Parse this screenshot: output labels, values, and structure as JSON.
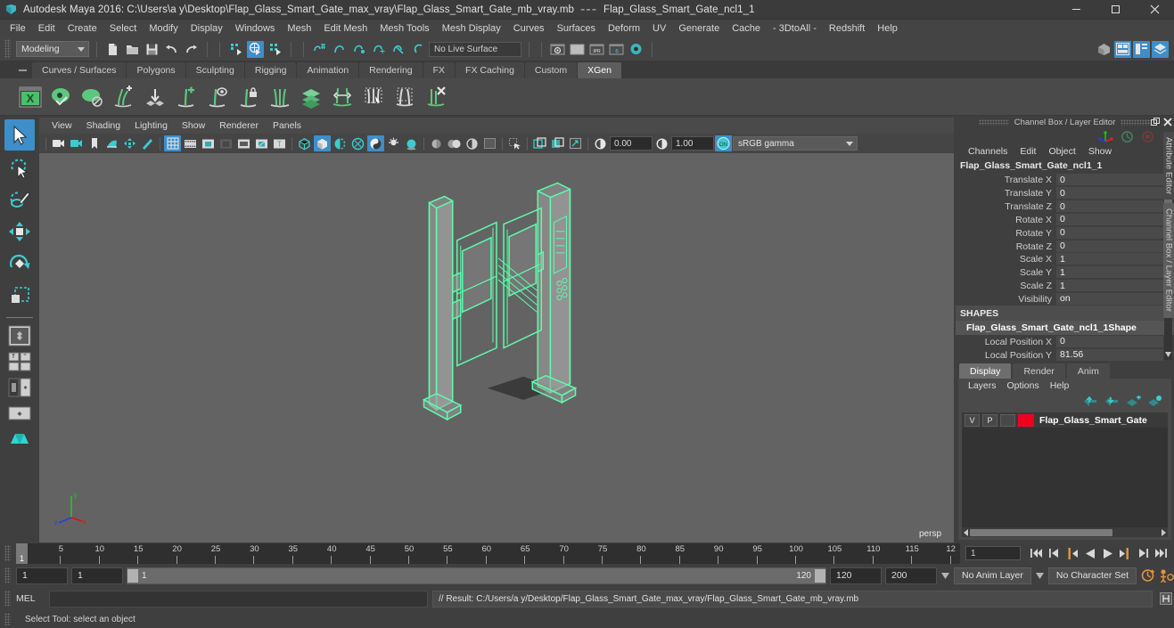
{
  "titlebar": {
    "app_title": "Autodesk Maya 2016: C:\\Users\\a y\\Desktop\\Flap_Glass_Smart_Gate_max_vray\\Flap_Glass_Smart_Gate_mb_vray.mb",
    "separator": "---",
    "selection_name": "Flap_Glass_Smart_Gate_ncl1_1",
    "minimize": "—",
    "maximize": "❐",
    "close": "✕"
  },
  "menubar": {
    "items": [
      "File",
      "Edit",
      "Create",
      "Select",
      "Modify",
      "Display",
      "Windows",
      "Mesh",
      "Edit Mesh",
      "Mesh Tools",
      "Mesh Display",
      "Curves",
      "Surfaces",
      "Deform",
      "UV",
      "Generate",
      "Cache",
      "- 3DtoAll -",
      "Redshift",
      "Help"
    ]
  },
  "statusline": {
    "menuset": "Modeling",
    "live_surface": "No Live Surface",
    "icons": [
      "new-scene-icon",
      "open-scene-icon",
      "save-scene-icon",
      "undo-icon",
      "redo-icon",
      "select-by-hierarchy-icon",
      "select-by-object-icon",
      "select-by-component-icon",
      "snap-to-grid-icon",
      "snap-to-curve-icon",
      "snap-to-point-icon",
      "snap-to-projected-center-icon",
      "snap-to-view-plane-icon",
      "make-live-icon"
    ],
    "render_icons": [
      "render-current-frame-icon",
      "ipr-render-icon",
      "render-settings-icon",
      "render-sequence-icon",
      "hypershade-icon"
    ],
    "right_icons": [
      "show-hide-modeling-toolkit-icon",
      "show-hide-attribute-editor-icon",
      "show-hide-tool-settings-icon",
      "show-hide-channel-box-icon"
    ]
  },
  "shelf": {
    "tabs": [
      "Curves / Surfaces",
      "Polygons",
      "Sculpting",
      "Rigging",
      "Animation",
      "Rendering",
      "FX",
      "FX Caching",
      "Custom",
      "XGen"
    ],
    "active_tab": "XGen",
    "icons": [
      "xgen-editor-icon",
      "xgen-preview-icon",
      "xgen-seed-icon",
      "xgen-add-guides-icon",
      "xgen-place-guide-icon",
      "xgen-add-grooming-icon",
      "xgen-guide-display-icon",
      "xgen-freeze-icon",
      "xgen-comb-icon",
      "xgen-density-icon",
      "xgen-length-icon",
      "xgen-width-icon",
      "xgen-clump-icon",
      "xgen-delete-icon"
    ]
  },
  "toolbox": {
    "items": [
      {
        "name": "select-tool",
        "selected": true
      },
      {
        "name": "lasso-select-tool",
        "selected": false
      },
      {
        "name": "paint-select-tool",
        "selected": false
      },
      {
        "name": "move-tool",
        "selected": false
      },
      {
        "name": "rotate-tool",
        "selected": false
      },
      {
        "name": "scale-tool",
        "selected": false
      }
    ],
    "layout_items": [
      "single-perspective-view-layout",
      "four-view-layout",
      "persp-outliner-layout",
      "persp-graph-layout",
      "hypershade-persp-layout"
    ]
  },
  "viewport": {
    "menus": [
      "View",
      "Shading",
      "Lighting",
      "Show",
      "Renderer",
      "Panels"
    ],
    "toolbar": {
      "exposure_value": "0.00",
      "gamma_value": "1.00",
      "color_management": "sRGB gamma",
      "cm_toggle": "on"
    },
    "camera_label": "persp",
    "axis": {
      "x": "x",
      "y": "y",
      "z": "z"
    },
    "model_color": "#5dfbab",
    "background_color": "#636363"
  },
  "channelbox": {
    "panel_title": "Channel Box / Layer Editor",
    "menus": [
      "Channels",
      "Edit",
      "Object",
      "Show"
    ],
    "object_name": "Flap_Glass_Smart_Gate_ncl1_1",
    "attributes": [
      {
        "label": "Translate X",
        "value": "0"
      },
      {
        "label": "Translate Y",
        "value": "0"
      },
      {
        "label": "Translate Z",
        "value": "0"
      },
      {
        "label": "Rotate X",
        "value": "0"
      },
      {
        "label": "Rotate Y",
        "value": "0"
      },
      {
        "label": "Rotate Z",
        "value": "0"
      },
      {
        "label": "Scale X",
        "value": "1"
      },
      {
        "label": "Scale Y",
        "value": "1"
      },
      {
        "label": "Scale Z",
        "value": "1"
      },
      {
        "label": "Visibility",
        "value": "on"
      }
    ],
    "shapes_header": "SHAPES",
    "shape_name": "Flap_Glass_Smart_Gate_ncl1_1Shape",
    "shape_attributes": [
      {
        "label": "Local Position X",
        "value": "0"
      },
      {
        "label": "Local Position Y",
        "value": "81.56"
      }
    ]
  },
  "layereditor": {
    "tabs": [
      "Display",
      "Render",
      "Anim"
    ],
    "active_tab": "Display",
    "menus": [
      "Layers",
      "Options",
      "Help"
    ],
    "buttons": [
      "move-layer-up-icon",
      "move-layer-down-icon",
      "create-empty-layer-icon",
      "create-layer-from-selected-icon"
    ],
    "layers": [
      {
        "visibility": "V",
        "playback": "P",
        "type": "",
        "color": "#f00020",
        "name": "Flap_Glass_Smart_Gate"
      }
    ]
  },
  "sidetabs": [
    "Attribute Editor",
    "Channel Box / Layer Editor"
  ],
  "timeslider": {
    "current_frame_label": "1",
    "current_frame_field": "1",
    "tick_labels": [
      "5",
      "10",
      "15",
      "20",
      "25",
      "30",
      "35",
      "40",
      "45",
      "50",
      "55",
      "60",
      "65",
      "70",
      "75",
      "80",
      "85",
      "90",
      "95",
      "100",
      "105",
      "110",
      "115",
      "12"
    ],
    "range_start": 1,
    "range_end": 120,
    "playback_buttons": [
      "go-to-start-icon",
      "step-back-keyframe-icon",
      "step-back-frame-icon",
      "play-backwards-icon",
      "play-forwards-icon",
      "step-forward-frame-icon",
      "step-forward-keyframe-icon",
      "go-to-end-icon"
    ]
  },
  "rangeslider": {
    "anim_start": "1",
    "range_start": "1",
    "bar_start_label": "1",
    "bar_end_label": "120",
    "range_end": "120",
    "anim_end": "200",
    "anim_layer": "No Anim Layer",
    "character_set": "No Character Set",
    "icons": [
      "auto-keyframe-toggle-icon",
      "animation-preferences-icon"
    ]
  },
  "commandline": {
    "language_label": "MEL",
    "input_value": "",
    "result_text": "// Result: C:/Users/a y/Desktop/Flap_Glass_Smart_Gate_max_vray/Flap_Glass_Smart_Gate_mb_vray.mb",
    "script_editor_icon": "script-editor-icon"
  },
  "helpline": {
    "text": "Select Tool: select an object"
  }
}
